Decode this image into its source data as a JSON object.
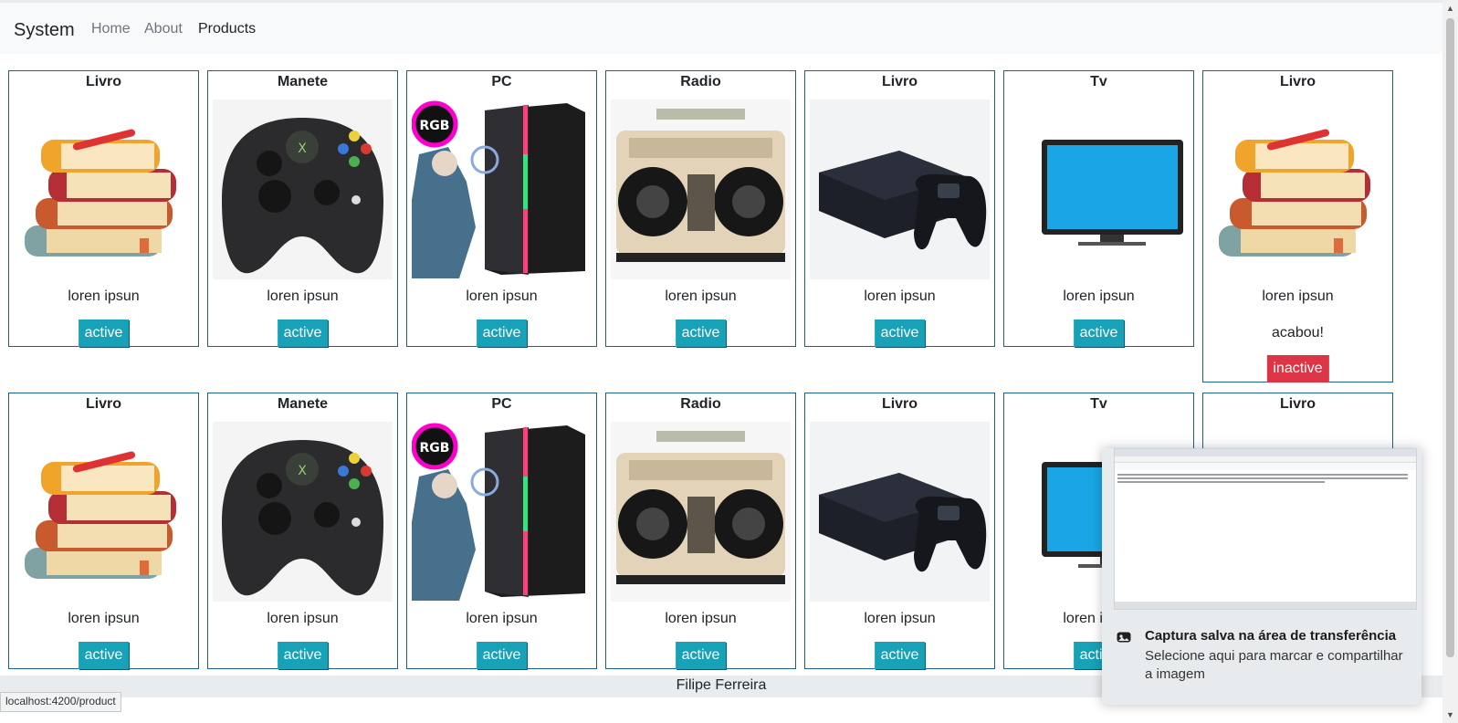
{
  "navbar": {
    "brand": "System",
    "links": [
      {
        "label": "Home",
        "active": false
      },
      {
        "label": "About",
        "active": false
      },
      {
        "label": "Products",
        "active": true
      }
    ]
  },
  "products_row1": [
    {
      "name": "Livro",
      "image": "books-image",
      "description": "loren ipsun",
      "status": "active",
      "extra_text": ""
    },
    {
      "name": "Manete",
      "image": "gamepad-image",
      "description": "loren ipsun",
      "status": "active",
      "extra_text": ""
    },
    {
      "name": "PC",
      "image": "pc-tower-image",
      "description": "loren ipsun",
      "status": "active",
      "extra_text": ""
    },
    {
      "name": "Radio",
      "image": "radio-image",
      "description": "loren ipsun",
      "status": "active",
      "extra_text": ""
    },
    {
      "name": "Livro",
      "image": "console-image",
      "description": "loren ipsun",
      "status": "active",
      "extra_text": ""
    },
    {
      "name": "Tv",
      "image": "tv-image",
      "description": "loren ipsun",
      "status": "active",
      "extra_text": ""
    },
    {
      "name": "Livro",
      "image": "books-image",
      "description": "loren ipsun",
      "status": "inactive",
      "extra_text": "acabou!"
    }
  ],
  "products_row2": [
    {
      "name": "Livro",
      "image": "books-image",
      "description": "loren ipsun",
      "status": "active"
    },
    {
      "name": "Manete",
      "image": "gamepad-image",
      "description": "loren ipsun",
      "status": "active"
    },
    {
      "name": "PC",
      "image": "pc-tower-image",
      "description": "loren ipsun",
      "status": "active"
    },
    {
      "name": "Radio",
      "image": "radio-image",
      "description": "loren ipsun",
      "status": "active"
    },
    {
      "name": "Livro",
      "image": "console-image",
      "description": "loren ipsun",
      "status": "active"
    },
    {
      "name": "Tv",
      "image": "tv-image",
      "description": "loren ipsun",
      "status": "active"
    },
    {
      "name": "Livro",
      "image": "books-image",
      "description": "",
      "status": ""
    }
  ],
  "footer": {
    "text": "Filipe Ferreira"
  },
  "status_url": "localhost:4200/product",
  "toast": {
    "title": "Captura salva na área de transferência",
    "body": "Selecione aqui para marcar e compartilhar a imagem"
  },
  "colors": {
    "active": "#17a2b8",
    "inactive": "#dc3545",
    "card_border": "#1d5f93"
  }
}
